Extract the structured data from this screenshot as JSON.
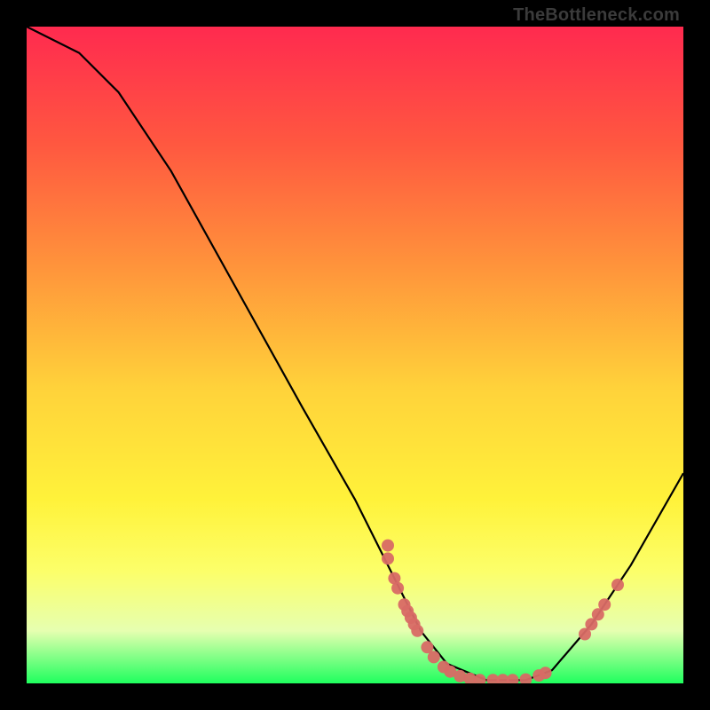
{
  "attribution": "TheBottleneck.com",
  "chart_data": {
    "type": "line",
    "title": "",
    "xlabel": "",
    "ylabel": "",
    "xlim": [
      0,
      100
    ],
    "ylim": [
      0,
      100
    ],
    "curve": [
      {
        "x": 0,
        "y": 100
      },
      {
        "x": 8,
        "y": 96
      },
      {
        "x": 14,
        "y": 90
      },
      {
        "x": 22,
        "y": 78
      },
      {
        "x": 32,
        "y": 60
      },
      {
        "x": 42,
        "y": 42
      },
      {
        "x": 50,
        "y": 28
      },
      {
        "x": 56,
        "y": 16
      },
      {
        "x": 60,
        "y": 8
      },
      {
        "x": 64,
        "y": 3
      },
      {
        "x": 70,
        "y": 0.5
      },
      {
        "x": 76,
        "y": 0.5
      },
      {
        "x": 80,
        "y": 2
      },
      {
        "x": 86,
        "y": 9
      },
      {
        "x": 92,
        "y": 18
      },
      {
        "x": 100,
        "y": 32
      }
    ],
    "dots": [
      {
        "x": 55,
        "y": 19
      },
      {
        "x": 55,
        "y": 21
      },
      {
        "x": 56,
        "y": 16
      },
      {
        "x": 56.5,
        "y": 14.5
      },
      {
        "x": 57.5,
        "y": 12
      },
      {
        "x": 58,
        "y": 11
      },
      {
        "x": 58.5,
        "y": 10
      },
      {
        "x": 59,
        "y": 9
      },
      {
        "x": 59.5,
        "y": 8
      },
      {
        "x": 61,
        "y": 5.5
      },
      {
        "x": 62,
        "y": 4
      },
      {
        "x": 63.5,
        "y": 2.5
      },
      {
        "x": 64.5,
        "y": 1.8
      },
      {
        "x": 66,
        "y": 1.1
      },
      {
        "x": 67.5,
        "y": 0.7
      },
      {
        "x": 69,
        "y": 0.5
      },
      {
        "x": 71,
        "y": 0.5
      },
      {
        "x": 72.5,
        "y": 0.5
      },
      {
        "x": 74,
        "y": 0.5
      },
      {
        "x": 76,
        "y": 0.6
      },
      {
        "x": 78,
        "y": 1.2
      },
      {
        "x": 79,
        "y": 1.6
      },
      {
        "x": 85,
        "y": 7.5
      },
      {
        "x": 86,
        "y": 9
      },
      {
        "x": 87,
        "y": 10.5
      },
      {
        "x": 88,
        "y": 12
      },
      {
        "x": 90,
        "y": 15
      }
    ]
  },
  "colors": {
    "curve": "#000000",
    "dot": "#d86a65",
    "bg_top": "#ff2a4f",
    "bg_bottom": "#1fff5e"
  }
}
